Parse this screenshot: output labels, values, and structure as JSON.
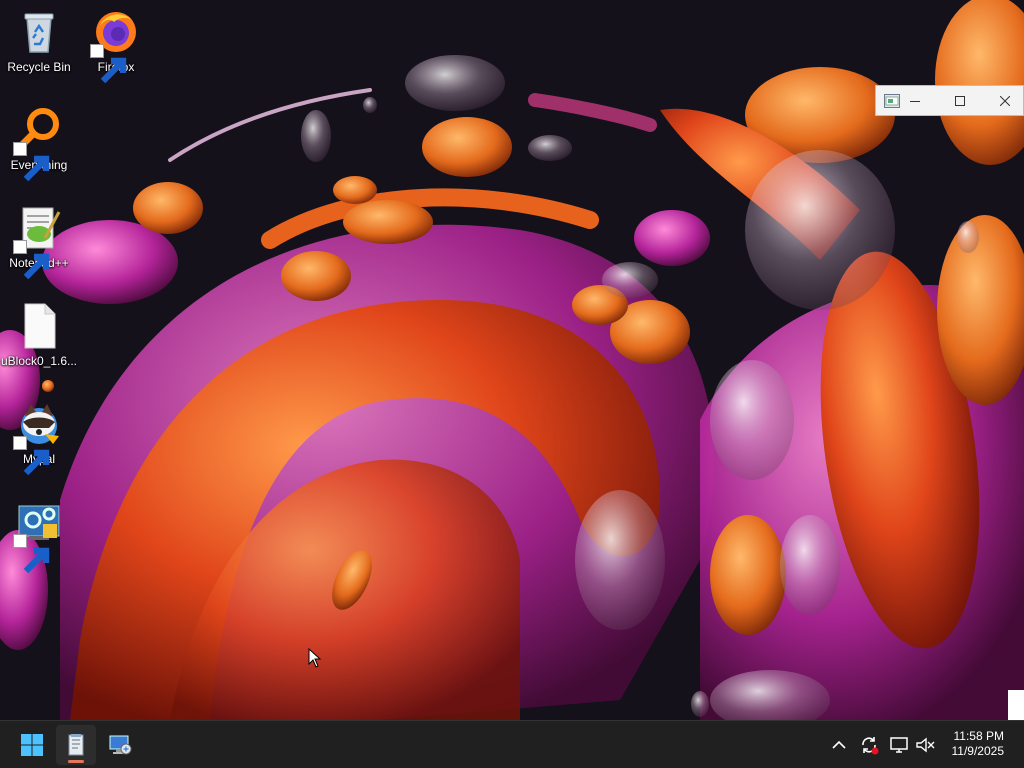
{
  "desktop_icons": [
    {
      "label": "Recycle Bin",
      "icon": "recycle-bin-icon"
    },
    {
      "label": "Firefox",
      "icon": "firefox-icon"
    },
    {
      "label": "Everything",
      "icon": "everything-search-icon"
    },
    {
      "label": "Notepad++",
      "icon": "notepad-plus-plus-icon"
    },
    {
      "label": "uBlock0_1.6...",
      "icon": "blank-file-icon"
    },
    {
      "label": "Mypal",
      "icon": "mypal-browser-icon"
    },
    {
      "label": "",
      "icon": "settings-shortcut-icon"
    }
  ],
  "taskbar": {
    "start_icon": "windows-start-icon",
    "apps": [
      {
        "name": "notepad-app",
        "active": true
      },
      {
        "name": "network-computer-app",
        "active": false
      }
    ]
  },
  "tray": {
    "time": "11:58 PM",
    "date": "11/9/2025"
  },
  "colors": {
    "taskbar_bg": "#202020",
    "accent": "#e5785a"
  }
}
